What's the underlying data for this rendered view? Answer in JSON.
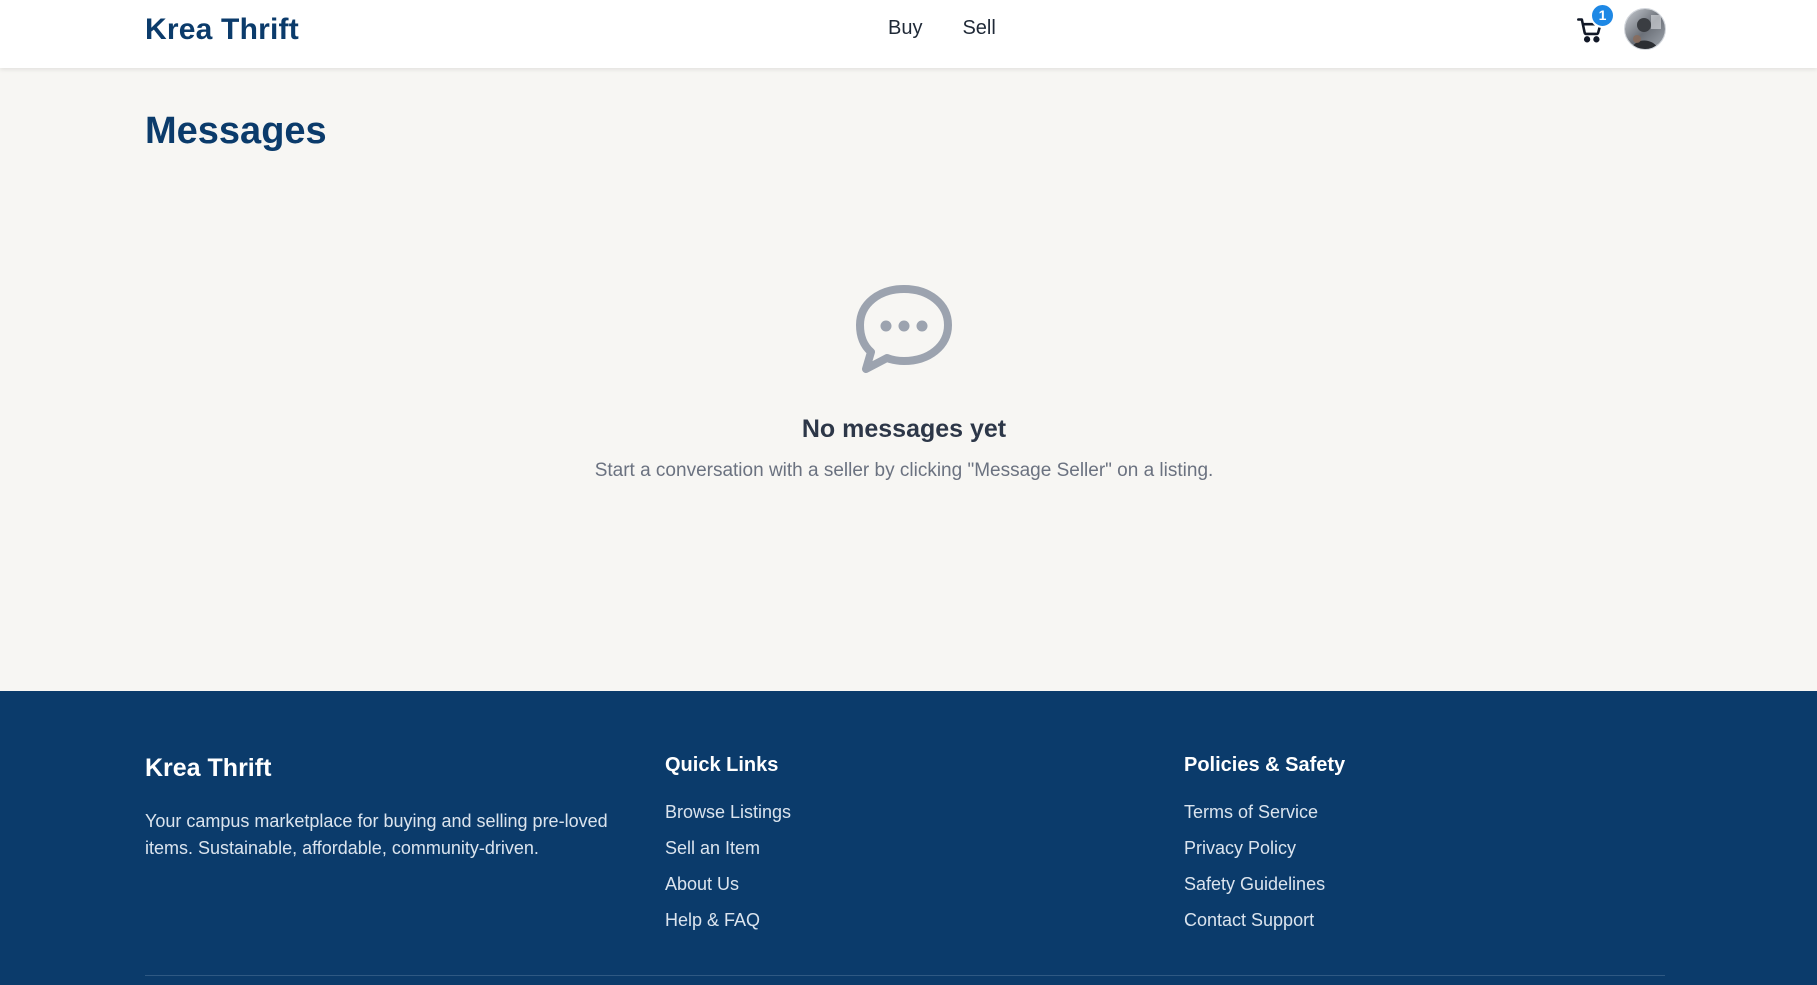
{
  "header": {
    "brand": "Krea Thrift",
    "nav": [
      {
        "label": "Buy"
      },
      {
        "label": "Sell"
      }
    ],
    "cart_count": "1"
  },
  "main": {
    "title": "Messages",
    "empty_title": "No messages yet",
    "empty_text": "Start a conversation with a seller by clicking \"Message Seller\" on a listing."
  },
  "footer": {
    "brand": "Krea Thrift",
    "description": "Your campus marketplace for buying and selling pre-loved items. Sustainable, affordable, community-driven.",
    "quick_links": {
      "heading": "Quick Links",
      "items": [
        "Browse Listings",
        "Sell an Item",
        "About Us",
        "Help & FAQ"
      ]
    },
    "policies": {
      "heading": "Policies & Safety",
      "items": [
        "Terms of Service",
        "Privacy Policy",
        "Safety Guidelines",
        "Contact Support"
      ]
    }
  },
  "colors": {
    "brand_navy": "#0b3b6b",
    "badge_blue": "#1e88e5",
    "page_bg": "#f7f6f3",
    "icon_gray": "#9ca3af"
  },
  "icons": {
    "cart": "shopping-cart-icon",
    "empty": "chat-bubble-icon",
    "avatar": "user-avatar"
  }
}
